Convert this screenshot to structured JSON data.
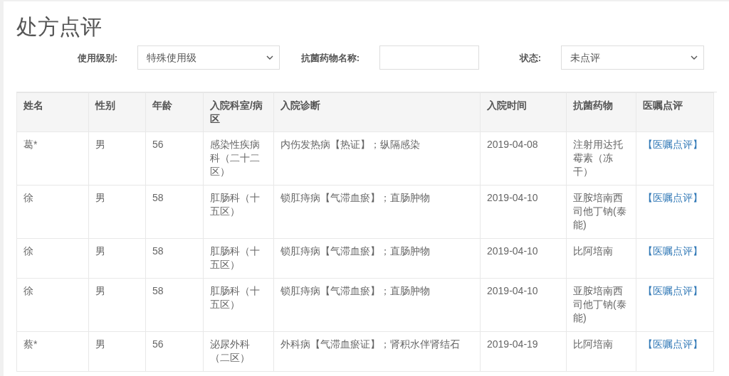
{
  "title": "处方点评",
  "filters": [
    {
      "kind": "select",
      "label": "使用级别:",
      "value": "特殊使用级"
    },
    {
      "kind": "input",
      "label": "抗菌药物名称:"
    },
    {
      "kind": "select",
      "label": "状态:",
      "value": "未点评"
    }
  ],
  "table": {
    "columns": [
      "姓名",
      "性别",
      "年龄",
      "入院科室/病区",
      "入院诊断",
      "入院时间",
      "抗菌药物",
      "医嘱点评"
    ],
    "rows": [
      {
        "cells": [
          "葛*",
          "男",
          "56",
          "感染性疾病科（二十二区）",
          "内伤发热病【热证】；纵隔感染",
          "2019-04-08",
          "注射用达托霉素（冻干）"
        ],
        "action": "【医嘱点评】"
      },
      {
        "cells": [
          "徐",
          "男",
          "58",
          "肛肠科（十五区）",
          "锁肛痔病【气滞血瘀】；直肠肿物",
          "2019-04-10",
          "亚胺培南西司他丁钠(泰能)"
        ],
        "action": "【医嘱点评】"
      },
      {
        "cells": [
          "徐",
          "男",
          "58",
          "肛肠科（十五区）",
          "锁肛痔病【气滞血瘀】；直肠肿物",
          "2019-04-10",
          "比阿培南"
        ],
        "action": "【医嘱点评】"
      },
      {
        "cells": [
          "徐",
          "男",
          "58",
          "肛肠科（十五区）",
          "锁肛痔病【气滞血瘀】；直肠肿物",
          "2019-04-10",
          "亚胺培南西司他丁钠(泰能)"
        ],
        "action": "【医嘱点评】"
      },
      {
        "cells": [
          "蔡*",
          "男",
          "56",
          "泌尿外科（二区）",
          "外科病【气滞血瘀证】；肾积水伴肾结石",
          "2019-04-19",
          "比阿培南"
        ],
        "action": "【医嘱点评】"
      }
    ]
  }
}
